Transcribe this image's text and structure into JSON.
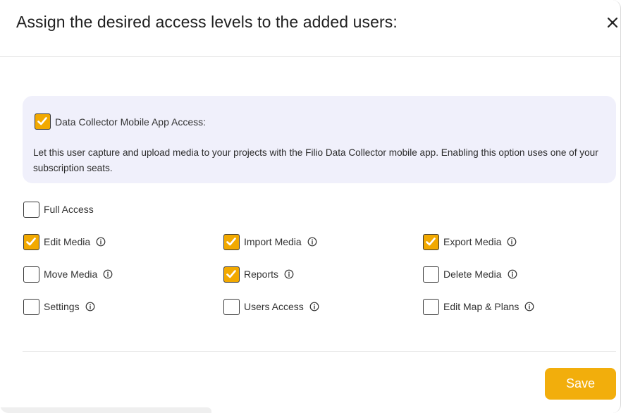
{
  "dialog": {
    "title": "Assign the desired access levels to the added users:",
    "close_icon": "close-icon"
  },
  "mobile_access": {
    "label": "Data Collector Mobile App Access:",
    "checked": true,
    "description": "Let this user capture and upload media to your projects with the Filio Data Collector mobile app. Enabling this option uses one of your subscription seats."
  },
  "full_access": {
    "label": "Full Access",
    "checked": false
  },
  "permissions": [
    {
      "label": "Edit Media",
      "checked": true
    },
    {
      "label": "Import Media",
      "checked": true
    },
    {
      "label": "Export Media",
      "checked": true
    },
    {
      "label": "Move Media",
      "checked": false
    },
    {
      "label": "Reports",
      "checked": true
    },
    {
      "label": "Delete Media",
      "checked": false
    },
    {
      "label": "Settings",
      "checked": false
    },
    {
      "label": "Users Access",
      "checked": false
    },
    {
      "label": "Edit Map & Plans",
      "checked": false
    }
  ],
  "footer": {
    "save_label": "Save"
  },
  "colors": {
    "accent": "#f2ae0c",
    "checkbox_checked": "#f2a900",
    "info_box_bg": "#f0f0fb"
  }
}
